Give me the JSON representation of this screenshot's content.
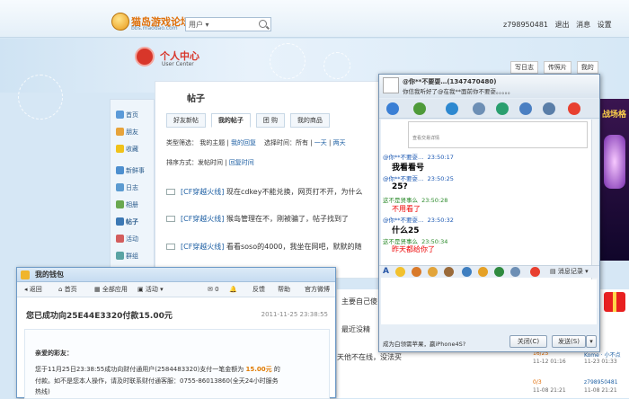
{
  "topbar": {
    "logo_title": "猫岛游戏论坛",
    "logo_sub": "bbs.maodao.com",
    "search_select": "用户",
    "user_links": [
      "z798950481",
      "退出",
      "消息",
      "设置"
    ]
  },
  "hero": {
    "uc_title": "个人中心",
    "uc_sub": "User Center",
    "buttons": [
      "写日志",
      "传照片",
      "我的"
    ]
  },
  "sidebar": {
    "items": [
      "首页",
      "朋友",
      "收藏",
      "新鲜事",
      "日志",
      "相册",
      "帖子",
      "活动",
      "群组"
    ]
  },
  "main": {
    "title": "帖子",
    "tabs": [
      "好友新帖",
      "我的帖子",
      "团 购",
      "我的商品"
    ],
    "filter_label": "类型筛选：",
    "filter_values": [
      "我的主题",
      "我的回复"
    ],
    "time_label": "选择时间：所有",
    "time_values": [
      "一天",
      "两天"
    ],
    "sort_label": "排序方式：",
    "sort_values": [
      "发帖时间",
      "回复时间"
    ],
    "posts": [
      {
        "tag": "[CF穿越火线]",
        "text": " 现在cdkey不能兑换，网页打不开，为什么"
      },
      {
        "tag": "[CF穿越火线]",
        "text": " 猴岛管理在不，刚被骗了，帖子找到了"
      },
      {
        "tag": "[CF穿越火线]",
        "text": " 看看soso的4000，我坐在网吧，默默的随"
      }
    ]
  },
  "bgposts": {
    "lines": [
      "主要自己傻",
      "最近没精",
      "天他不在线，没法买"
    ],
    "meta": [
      {
        "count": "16/25",
        "date": "11-12 01:16",
        "user": "Kome · 小不点",
        "udate": "11-23 01:33"
      },
      {
        "count": "0/3",
        "date": "11-08 21:21",
        "user": "z798950481",
        "udate": "11-08 21:21"
      }
    ]
  },
  "wallet": {
    "title": "我的钱包",
    "toolbar": [
      "返回",
      "首页",
      "全部应用",
      "活动",
      "0",
      "反馈",
      "帮助",
      "官方微博"
    ],
    "subject": "您已成功向25E44E3320付款15.00元",
    "date": "2011-11-25 23:38:55",
    "greeting": "亲爱的彩友：",
    "line1_pre": "您于11月25日23:38:55成功向财付通用户(2584483320)支付一笔金额为",
    "amount": "15.00元",
    "line1_post": "的",
    "line2": "付款。如不是您本人操作，请及时联系财付通客服：0755-86013860(全天24小时服务",
    "line3": "热线)"
  },
  "chat": {
    "name": "@你**不要耍…(1347470480)",
    "signature": "你信我听好了@在我**面前你不要耍。。。。。",
    "ad_text": "查看交易详情",
    "messages": [
      {
        "sender": "@你**不要耍…",
        "time": "23:50:17",
        "text": "我看看号",
        "style": "bold"
      },
      {
        "sender": "@你**不要耍…",
        "time": "23:50:25",
        "text": "25?",
        "style": "bold"
      },
      {
        "sender": "这不是贤事么",
        "time": "23:50:28",
        "text": "不用看了",
        "style": "red"
      },
      {
        "sender": "@你**不要耍…",
        "time": "23:50:32",
        "text": "什么25",
        "style": "bold"
      },
      {
        "sender": "这不是贤事么",
        "time": "23:50:34",
        "text": "昨天都给你了",
        "style": "red"
      }
    ],
    "history_label": "消息记录",
    "note": "成为白领需苹果，赢iPhone4S?",
    "close_label": "关闭(C)",
    "send_label": "发送(S)"
  },
  "ad": {
    "title": "战场格"
  }
}
